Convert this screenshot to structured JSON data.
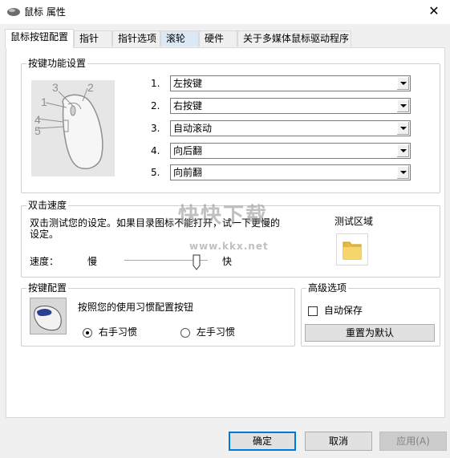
{
  "window": {
    "title": "鼠标 属性",
    "close_glyph": "✕"
  },
  "tabs": [
    {
      "label": "鼠标按钮配置",
      "active": true
    },
    {
      "label": "指针"
    },
    {
      "label": "指针选项"
    },
    {
      "label": "滚轮"
    },
    {
      "label": "硬件"
    },
    {
      "label": "关于多媒体鼠标驱动程序"
    }
  ],
  "button_settings": {
    "title": "按键功能设置",
    "rows": [
      {
        "num": "1.",
        "value": "左按键",
        "callout": "1"
      },
      {
        "num": "2.",
        "value": "右按键",
        "callout": "2"
      },
      {
        "num": "3.",
        "value": "自动滚动",
        "callout": "3"
      },
      {
        "num": "4.",
        "value": "向后翻",
        "callout": "4"
      },
      {
        "num": "5.",
        "value": "向前翻",
        "callout": "5"
      }
    ]
  },
  "double_click": {
    "title": "双击速度",
    "description_line1": "双击测试您的设定。如果目录图标不能打开，试一下更慢的",
    "description_line2": "设定。",
    "speed_label": "速度：",
    "slow_label": "慢",
    "fast_label": "快",
    "test_area_label": "测试区域",
    "speed_level": 0.87
  },
  "button_config": {
    "title": "按键配置",
    "description": "按照您的使用习惯配置按钮",
    "right_hand": "右手习惯",
    "left_hand": "左手习惯",
    "selected": "right"
  },
  "advanced": {
    "title": "高级选项",
    "autosave_label": "自动保存",
    "autosave_checked": false,
    "reset_button": "重置为默认"
  },
  "footer": {
    "ok": "确定",
    "cancel": "取消",
    "apply": "应用(A)"
  },
  "watermark": {
    "main": "快快下载",
    "sub": "www.kkx.net"
  }
}
